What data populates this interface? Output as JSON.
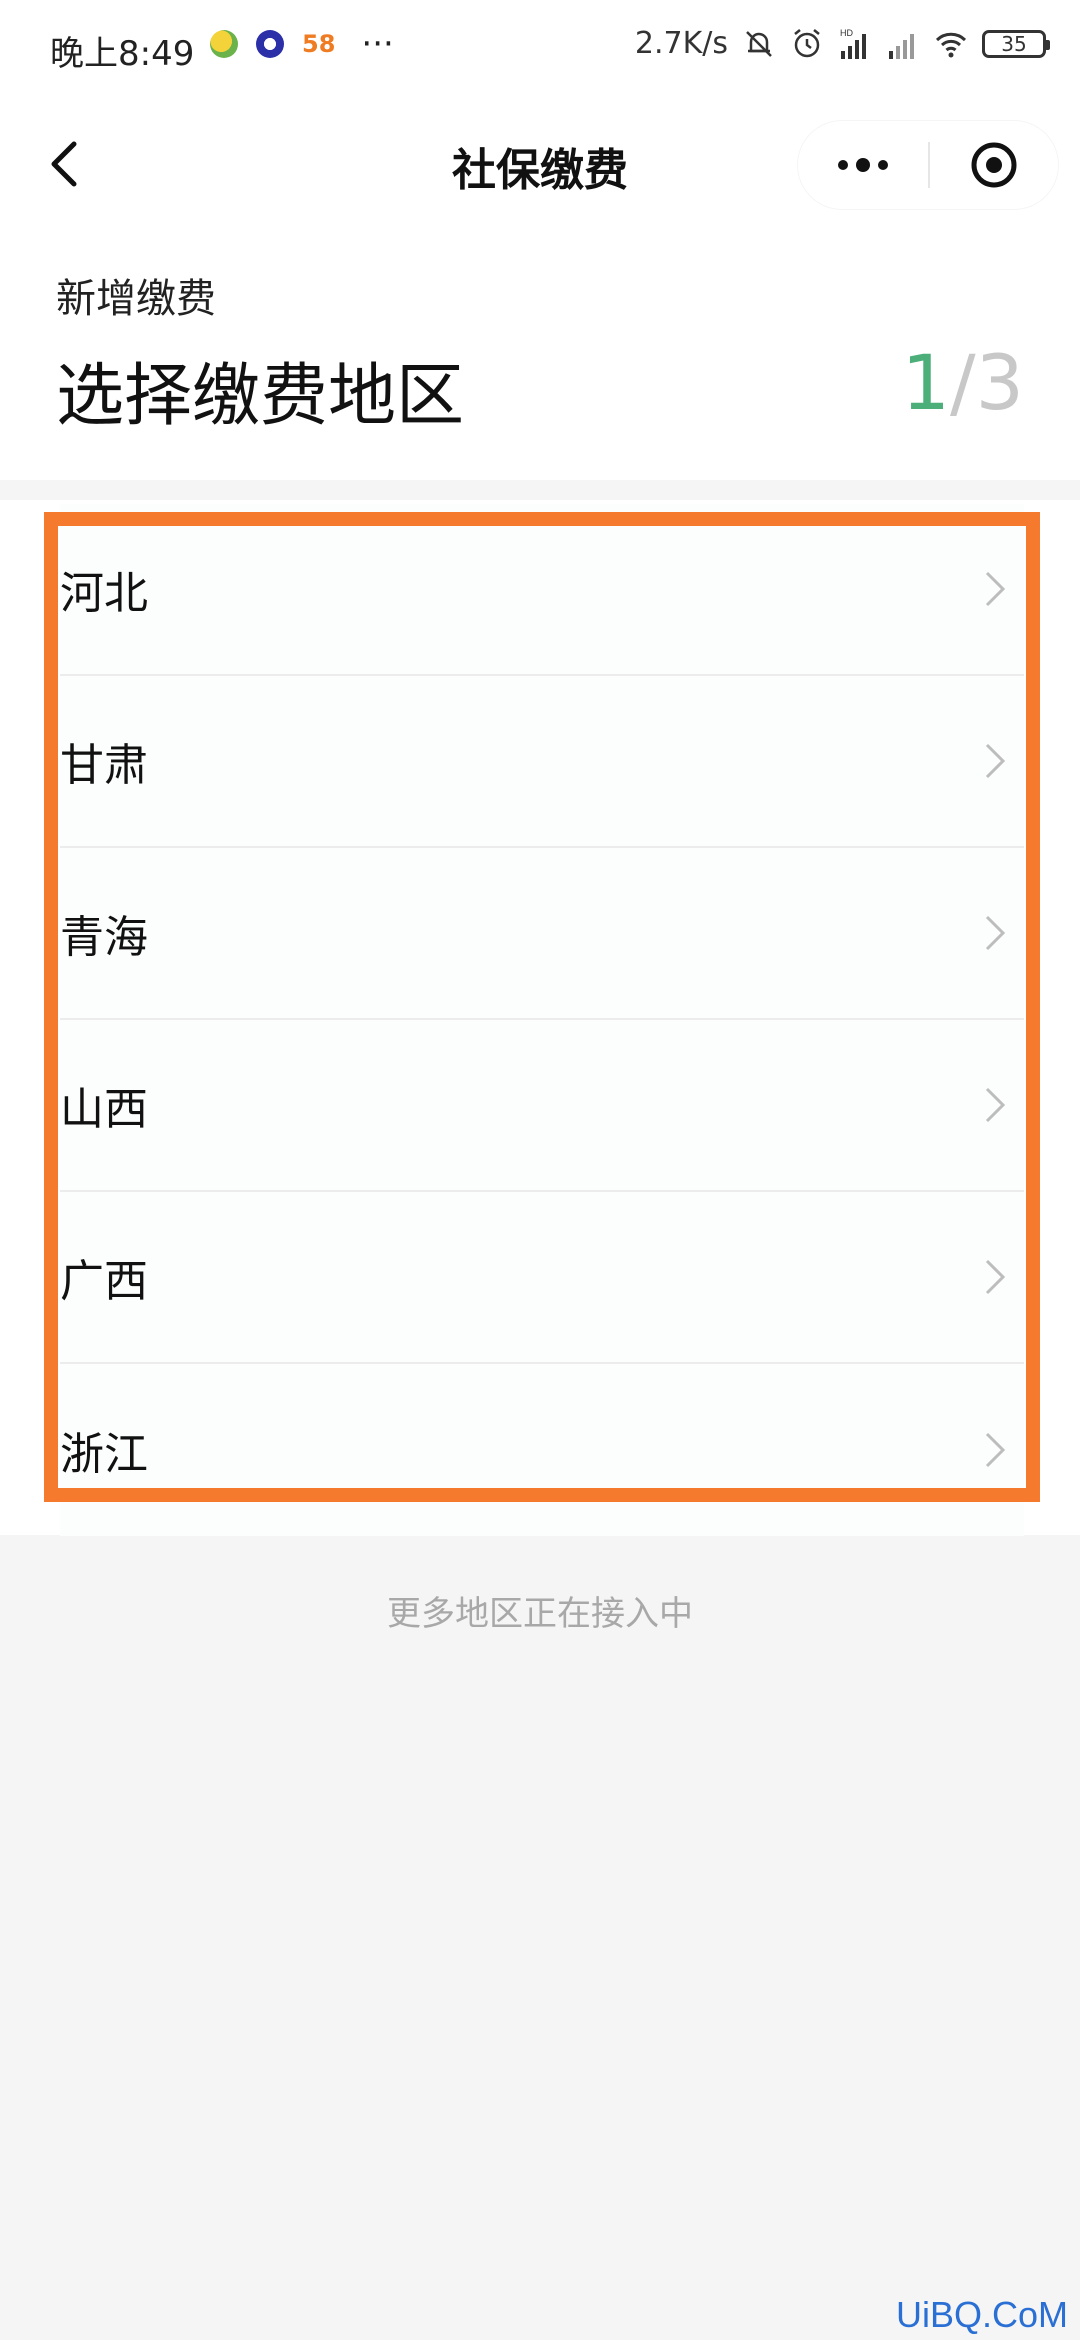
{
  "status_bar": {
    "time": "晚上8:49",
    "badge_58": "58",
    "more": "···",
    "net_speed": "2.7K/s",
    "battery": "35"
  },
  "nav": {
    "title": "社保缴费"
  },
  "header": {
    "subtitle": "新增缴费",
    "title": "选择缴费地区",
    "step_current": "1",
    "step_separator": "/",
    "step_total": "3"
  },
  "regions": [
    {
      "label": "河北"
    },
    {
      "label": "甘肃"
    },
    {
      "label": "青海"
    },
    {
      "label": "山西"
    },
    {
      "label": "广西"
    },
    {
      "label": "浙江"
    }
  ],
  "footer_note": "更多地区正在接入中",
  "watermark": "UiBQ.CoM",
  "colors": {
    "accent_green": "#4caf7a",
    "highlight_orange": "#f57a2e",
    "watermark_blue": "#2a6fd4"
  }
}
